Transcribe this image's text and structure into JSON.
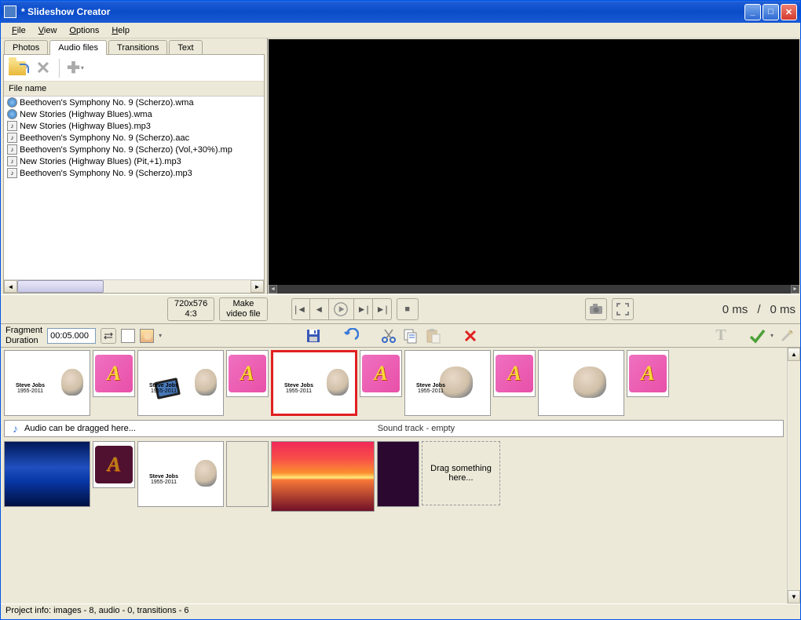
{
  "title": "*  Slideshow Creator",
  "menu": {
    "file": "File",
    "view": "View",
    "options": "Options",
    "help": "Help"
  },
  "tabs": {
    "photos": "Photos",
    "audio": "Audio files",
    "transitions": "Transitions",
    "text": "Text"
  },
  "file_header": "File name",
  "files": [
    {
      "icon": "wma",
      "name": "Beethoven's Symphony No. 9 (Scherzo).wma"
    },
    {
      "icon": "wma",
      "name": "New Stories (Highway Blues).wma"
    },
    {
      "icon": "mp3",
      "name": "New Stories (Highway Blues).mp3"
    },
    {
      "icon": "aac",
      "name": "Beethoven's Symphony No. 9 (Scherzo).aac"
    },
    {
      "icon": "mp3",
      "name": "Beethoven's Symphony No. 9 (Scherzo) (Vol,+30%).mp"
    },
    {
      "icon": "mp3",
      "name": "New Stories (Highway Blues) (Pit,+1).mp3"
    },
    {
      "icon": "mp3",
      "name": "Beethoven's Symphony No. 9 (Scherzo).mp3"
    }
  ],
  "res_btn": {
    "l1": "720x576",
    "l2": "4:3"
  },
  "make_btn": {
    "l1": "Make",
    "l2": "video file"
  },
  "time_left": "0 ms",
  "time_sep": "/",
  "time_right": "0 ms",
  "frag_label1": "Fragment",
  "frag_label2": "Duration",
  "frag_value": "00:05.000",
  "audio_hint": "Audio can be dragged here...",
  "sound_empty": "Sound track - empty",
  "drag_hint": "Drag something here...",
  "status": "Project info: images - 8, audio - 0, transitions - 6",
  "slides": {
    "s1": "Steve Jobs",
    "s1sub": "1955-2011",
    "trans_letter": "A"
  },
  "icons": {
    "save": "save-icon",
    "undo": "undo-icon",
    "cut": "cut-icon",
    "copy": "copy-icon",
    "paste": "paste-icon",
    "delete": "delete-icon",
    "text": "text-icon",
    "apply": "apply-icon",
    "wand": "wand-icon"
  }
}
